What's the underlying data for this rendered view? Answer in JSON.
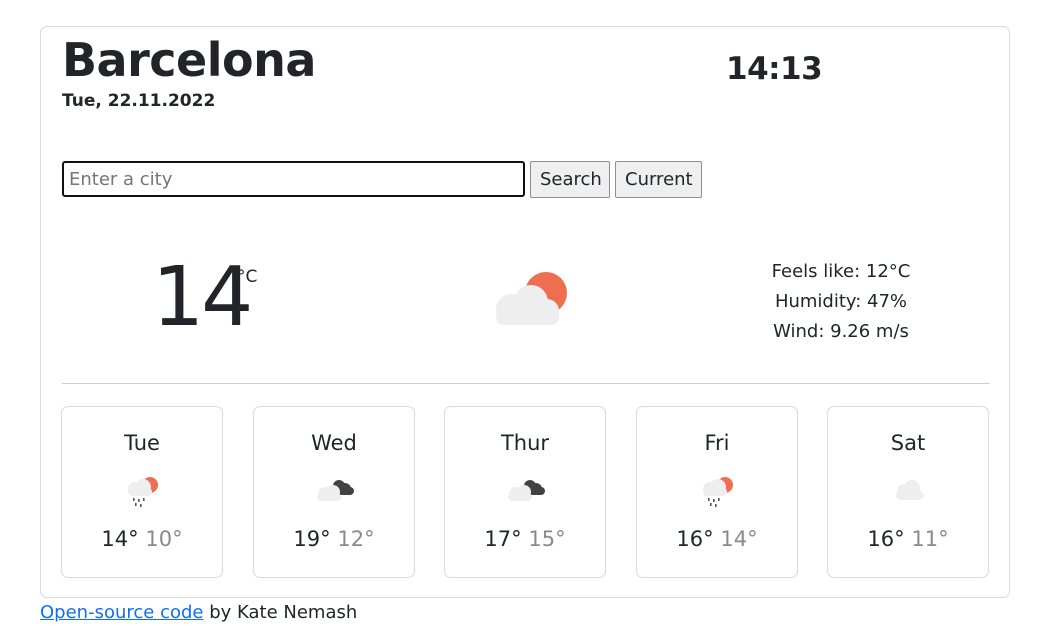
{
  "location": {
    "city": "Barcelona",
    "date": "Tue, 22.11.2022",
    "time": "14:13"
  },
  "search": {
    "placeholder": "Enter a city",
    "value": "",
    "search_label": "Search",
    "current_label": "Current"
  },
  "current": {
    "temperature": "14",
    "unit": "°C",
    "icon": "cloud-sun-icon",
    "feels_like": "Feels like: 12°C",
    "humidity": "Humidity: 47%",
    "wind": "Wind: 9.26 m/s"
  },
  "forecast": [
    {
      "day": "Tue",
      "icon": "rain-sun-icon",
      "max": "14°",
      "min": "10°"
    },
    {
      "day": "Wed",
      "icon": "broken-clouds-icon",
      "max": "19°",
      "min": "12°"
    },
    {
      "day": "Thur",
      "icon": "broken-clouds-icon",
      "max": "17°",
      "min": "15°"
    },
    {
      "day": "Fri",
      "icon": "rain-sun-icon",
      "max": "16°",
      "min": "14°"
    },
    {
      "day": "Sat",
      "icon": "cloud-icon",
      "max": "16°",
      "min": "11°"
    }
  ],
  "footer": {
    "link_text": "Open-source code",
    "by_text": " by Kate Nemash"
  },
  "colors": {
    "sun": "#ee6e4f",
    "cloud_light": "#eeeeee",
    "cloud_dark": "#424242",
    "link": "#0d6efd"
  }
}
